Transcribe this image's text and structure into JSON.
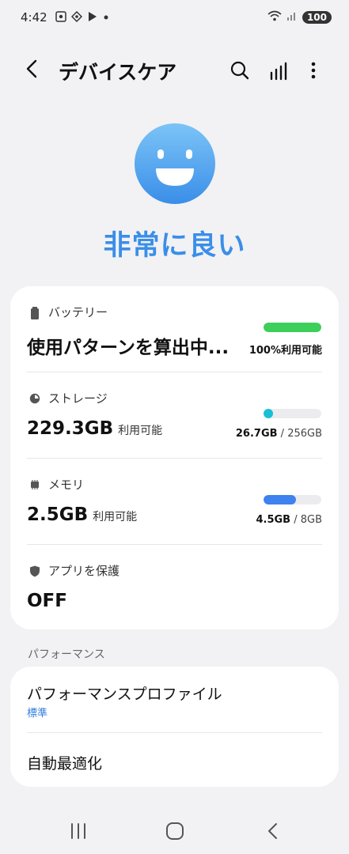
{
  "status_bar": {
    "time": "4:42",
    "battery": "100",
    "icons": [
      "screenshot-icon",
      "vpn-icon",
      "play-icon",
      "dot-icon",
      "wifi-icon",
      "signal-icon"
    ]
  },
  "app_bar": {
    "title": "デバイスケア",
    "actions": [
      "search-icon",
      "chart-icon",
      "more-icon"
    ]
  },
  "hero": {
    "status": "非常に良い",
    "accent": "#3a8ee8",
    "face_colors": [
      "#7cc4f7",
      "#3a8ee8"
    ]
  },
  "battery": {
    "label": "バッテリー",
    "value": "使用パターンを算出中...",
    "bar_fraction": 1.0,
    "bar_color": "#3ccf5a",
    "caption": "100%利用可能"
  },
  "storage": {
    "label": "ストレージ",
    "value": "229.3GB",
    "value_unit": "利用可能",
    "used": "26.7GB",
    "total": "256GB",
    "bar_fraction": 0.104,
    "bar_color": "#18bfd6"
  },
  "memory": {
    "label": "メモリ",
    "value": "2.5GB",
    "value_unit": "利用可能",
    "used": "4.5GB",
    "total": "8GB",
    "bar_fraction": 0.5625,
    "bar_color": "#3d82ef"
  },
  "app_protection": {
    "label": "アプリを保護",
    "value": "OFF"
  },
  "performance": {
    "section_title": "パフォーマンス",
    "profile_label": "パフォーマンスプロファイル",
    "profile_value": "標準",
    "auto_optimize_label": "自動最適化"
  },
  "nav": {
    "buttons": [
      "recents-icon",
      "home-icon",
      "back-icon"
    ]
  }
}
